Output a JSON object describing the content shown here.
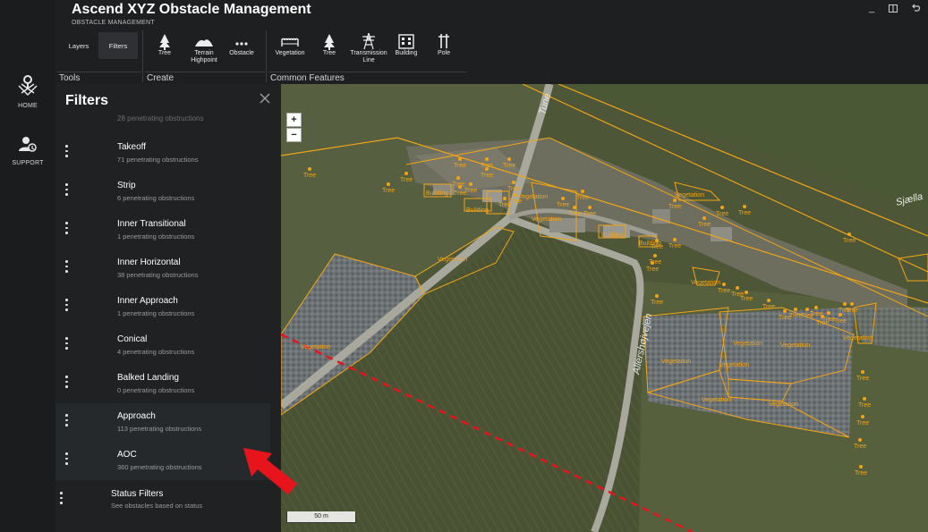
{
  "app": {
    "title": "Ascend XYZ Obstacle Management",
    "subtitle": "OBSTACLE MANAGEMENT"
  },
  "rail": {
    "home_label": "HOME",
    "support_label": "SUPPORT"
  },
  "ribbon": {
    "tools": {
      "label": "Tools",
      "tabs": [
        "Layers",
        "Filters"
      ],
      "active": "Filters"
    },
    "create": {
      "label": "Create",
      "buttons": [
        "Tree",
        "Terrain Highpoint",
        "Obstacle"
      ]
    },
    "common": {
      "label": "Common Features",
      "buttons": [
        "Vegetation",
        "Tree",
        "Transmission Line",
        "Building",
        "Pole"
      ]
    }
  },
  "filters": {
    "title": "Filters",
    "ghost_text": "28 penetrating obstructions",
    "items": [
      {
        "name": "Takeoff",
        "count": "71 penetrating obstructions"
      },
      {
        "name": "Strip",
        "count": "6 penetrating obstructions"
      },
      {
        "name": "Inner Transitional",
        "count": "1 penetrating obstructions"
      },
      {
        "name": "Inner Horizontal",
        "count": "38 penetrating obstructions"
      },
      {
        "name": "Inner Approach",
        "count": "1 penetrating obstructions"
      },
      {
        "name": "Conical",
        "count": "4 penetrating obstructions"
      },
      {
        "name": "Balked Landing",
        "count": "0 penetrating obstructions"
      },
      {
        "name": "Approach",
        "count": "113 penetrating obstructions"
      },
      {
        "name": "AOC",
        "count": "360 penetrating obstructions"
      }
    ],
    "status": {
      "name": "Status Filters",
      "desc": "See obstacles based on status"
    }
  },
  "map": {
    "zoom_in": "+",
    "zoom_out": "−",
    "scale": "50 m",
    "roads": [
      "Tune",
      "Allershøjvejen",
      "Sjælla"
    ],
    "labels": {
      "tree": "Tree",
      "vegetation": "Vegetation",
      "building": "Building"
    },
    "colors": {
      "obstacle": "#f2a416",
      "highlight_arrow": "#e8141c",
      "dashed_line": "#e8141c"
    }
  }
}
